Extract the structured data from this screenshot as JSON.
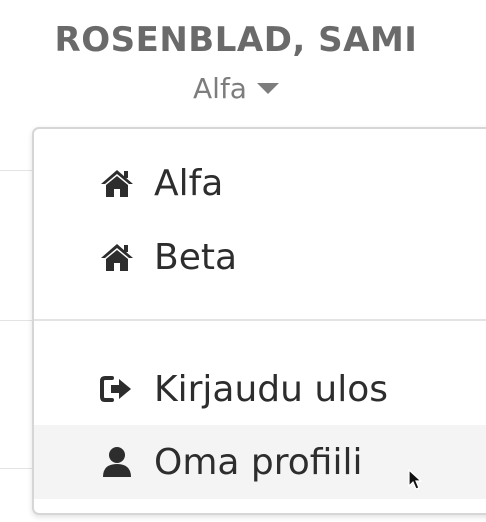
{
  "header": {
    "user_name": "ROSENBLAD, SAMI",
    "current_org": "Alfa"
  },
  "menu": {
    "orgs": [
      {
        "label": "Alfa",
        "icon": "home-icon"
      },
      {
        "label": "Beta",
        "icon": "home-icon"
      }
    ],
    "actions": [
      {
        "label": "Kirjaudu ulos",
        "icon": "sign-out-icon"
      },
      {
        "label": "Oma profiili",
        "icon": "user-icon",
        "state": "hover"
      }
    ]
  }
}
